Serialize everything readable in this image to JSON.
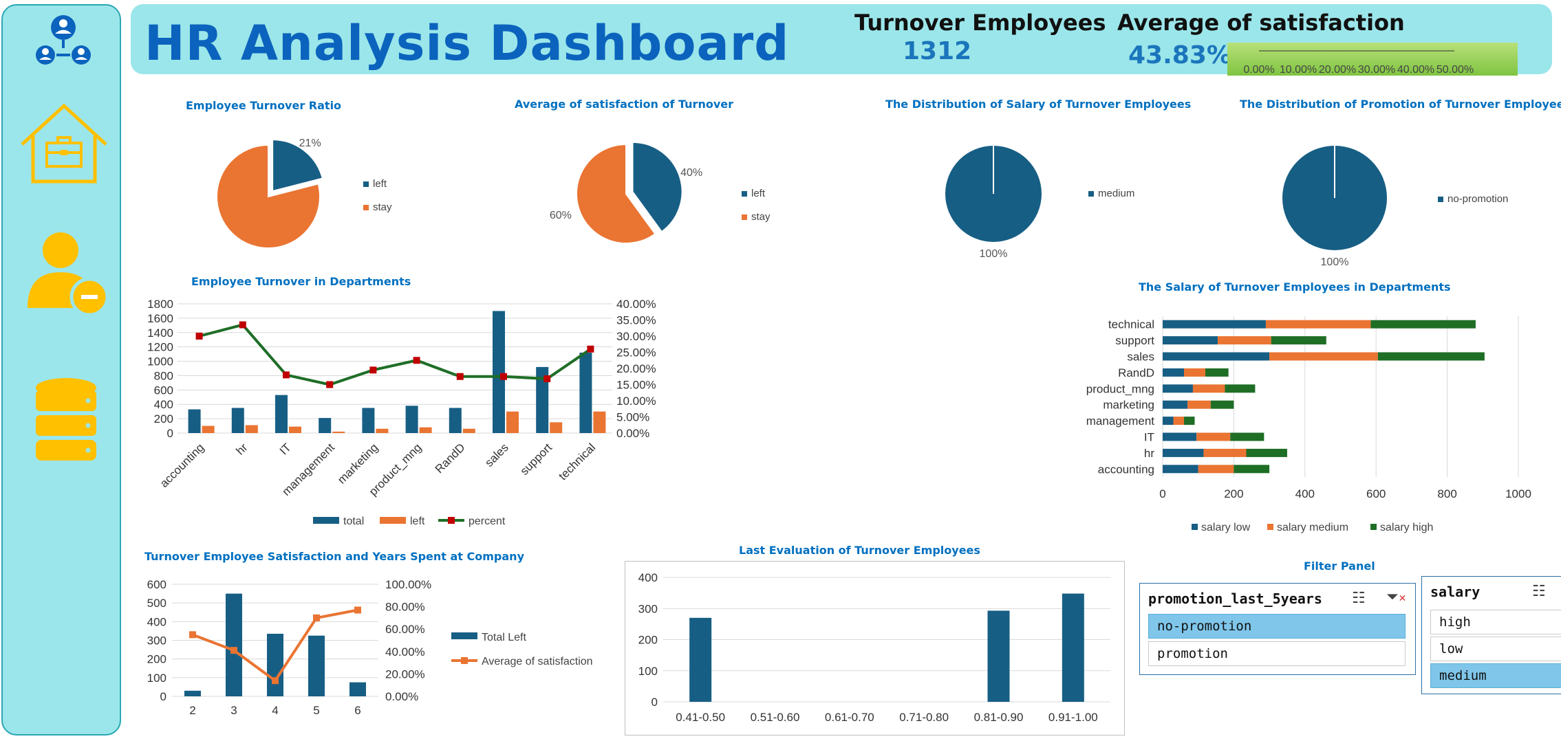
{
  "header": {
    "title": "HR  Analysis Dashboard",
    "kpi_turnover_label": "Turnover  Employees",
    "kpi_turnover_value": "1312",
    "kpi_satisfaction_label": "Average  of  satisfaction",
    "kpi_satisfaction_value": "43.83%",
    "gauge": {
      "ticks": [
        "0.00%",
        "10.00%",
        "20.00%",
        "30.00%",
        "40.00%",
        "50.00%"
      ],
      "value": 43.83,
      "max": 50
    }
  },
  "sidebar": {
    "icons": [
      "org-network-icon",
      "house-briefcase-icon",
      "user-minus-icon",
      "database-icon"
    ],
    "accent": "#ffc000"
  },
  "colors": {
    "blue": "#175e84",
    "orange": "#ea7432",
    "green": "#1e6e26",
    "marker": "#c00000"
  },
  "chart_data": [
    {
      "id": "turnover_ratio",
      "type": "pie",
      "title": "Employee Turnover Ratio",
      "labels": [
        "left",
        "stay"
      ],
      "values": [
        21,
        79
      ],
      "data_labels": [
        "21%",
        ""
      ]
    },
    {
      "id": "satisfaction_turnover",
      "type": "pie",
      "title": "Average of satisfaction of Turnover",
      "labels": [
        "left",
        "stay"
      ],
      "values": [
        40,
        60
      ],
      "data_labels": [
        "40%",
        "60%"
      ]
    },
    {
      "id": "salary_distribution",
      "type": "pie",
      "title": "The Distribution of Salary of Turnover Employees",
      "labels": [
        "medium"
      ],
      "values": [
        100
      ],
      "data_labels": [
        "100%"
      ]
    },
    {
      "id": "promotion_distribution",
      "type": "pie",
      "title": "The Distribution of Promotion of Turnover Employees",
      "labels": [
        "no-promotion"
      ],
      "values": [
        100
      ],
      "data_labels": [
        "100%"
      ]
    },
    {
      "id": "turnover_departments",
      "type": "bar",
      "title": "Employee Turnover  in Departments",
      "categories": [
        "accounting",
        "hr",
        "IT",
        "management",
        "marketing",
        "product_mng",
        "RandD",
        "sales",
        "support",
        "technical"
      ],
      "series": [
        {
          "name": "total",
          "values": [
            330,
            350,
            530,
            210,
            350,
            380,
            350,
            1700,
            920,
            1120
          ]
        },
        {
          "name": "left",
          "values": [
            100,
            110,
            90,
            20,
            60,
            80,
            60,
            300,
            150,
            300
          ]
        },
        {
          "name": "percent",
          "values": [
            30,
            33.5,
            18,
            15,
            19.5,
            22.5,
            17.5,
            17.5,
            16.8,
            26
          ]
        }
      ],
      "y_ticks": [
        "0",
        "200",
        "400",
        "600",
        "800",
        "1000",
        "1200",
        "1400",
        "1600",
        "1800"
      ],
      "y2_ticks": [
        "0.00%",
        "5.00%",
        "10.00%",
        "15.00%",
        "20.00%",
        "25.00%",
        "30.00%",
        "35.00%",
        "40.00%"
      ],
      "ylim": [
        0,
        1800
      ],
      "y2lim": [
        0,
        40
      ]
    },
    {
      "id": "salary_departments",
      "type": "bar",
      "title": "The Salary of Turnover Employees in Departments",
      "categories": [
        "accounting",
        "hr",
        "IT",
        "management",
        "marketing",
        "product_mng",
        "RandD",
        "sales",
        "support",
        "technical"
      ],
      "series": [
        {
          "name": "salary low",
          "values": [
            100,
            115,
            95,
            30,
            70,
            85,
            60,
            300,
            155,
            290
          ]
        },
        {
          "name": "salary medium",
          "values": [
            100,
            120,
            95,
            30,
            65,
            90,
            60,
            305,
            150,
            295
          ]
        },
        {
          "name": "salary high",
          "values": [
            100,
            115,
            95,
            30,
            65,
            85,
            65,
            300,
            155,
            295
          ]
        }
      ],
      "x_ticks": [
        "0",
        "200",
        "400",
        "600",
        "800",
        "1000"
      ],
      "xlim": [
        0,
        1000
      ]
    },
    {
      "id": "satisfaction_years",
      "type": "bar",
      "title": "Turnover Employee Satisfaction and Years Spent at Company",
      "categories": [
        "2",
        "3",
        "4",
        "5",
        "6"
      ],
      "series": [
        {
          "name": "Total Left",
          "values": [
            30,
            550,
            335,
            325,
            75
          ]
        },
        {
          "name": "Average of satisfaction",
          "values": [
            55,
            41,
            14,
            70,
            77
          ]
        }
      ],
      "y_ticks": [
        "0",
        "100",
        "200",
        "300",
        "400",
        "500",
        "600"
      ],
      "y2_ticks": [
        "0.00%",
        "20.00%",
        "40.00%",
        "60.00%",
        "80.00%",
        "100.00%"
      ],
      "ylim": [
        0,
        600
      ],
      "y2lim": [
        0,
        100
      ]
    },
    {
      "id": "last_evaluation",
      "type": "bar",
      "title": "Last Evaluation of Turnover Employees",
      "categories": [
        "0.41-0.50",
        "0.51-0.60",
        "0.61-0.70",
        "0.71-0.80",
        "0.81-0.90",
        "0.91-1.00"
      ],
      "values": [
        270,
        0,
        0,
        0,
        293,
        348
      ],
      "y_ticks": [
        "0",
        "100",
        "200",
        "300",
        "400"
      ],
      "ylim": [
        0,
        400
      ]
    }
  ],
  "filter_panel": {
    "title": "Filter Panel",
    "promotion": {
      "header": "promotion_last_5years",
      "items": [
        "no-promotion",
        "promotion"
      ],
      "selected": [
        0
      ]
    },
    "salary": {
      "header": "salary",
      "items": [
        "high",
        "low",
        "medium"
      ],
      "selected": [
        2
      ]
    }
  }
}
